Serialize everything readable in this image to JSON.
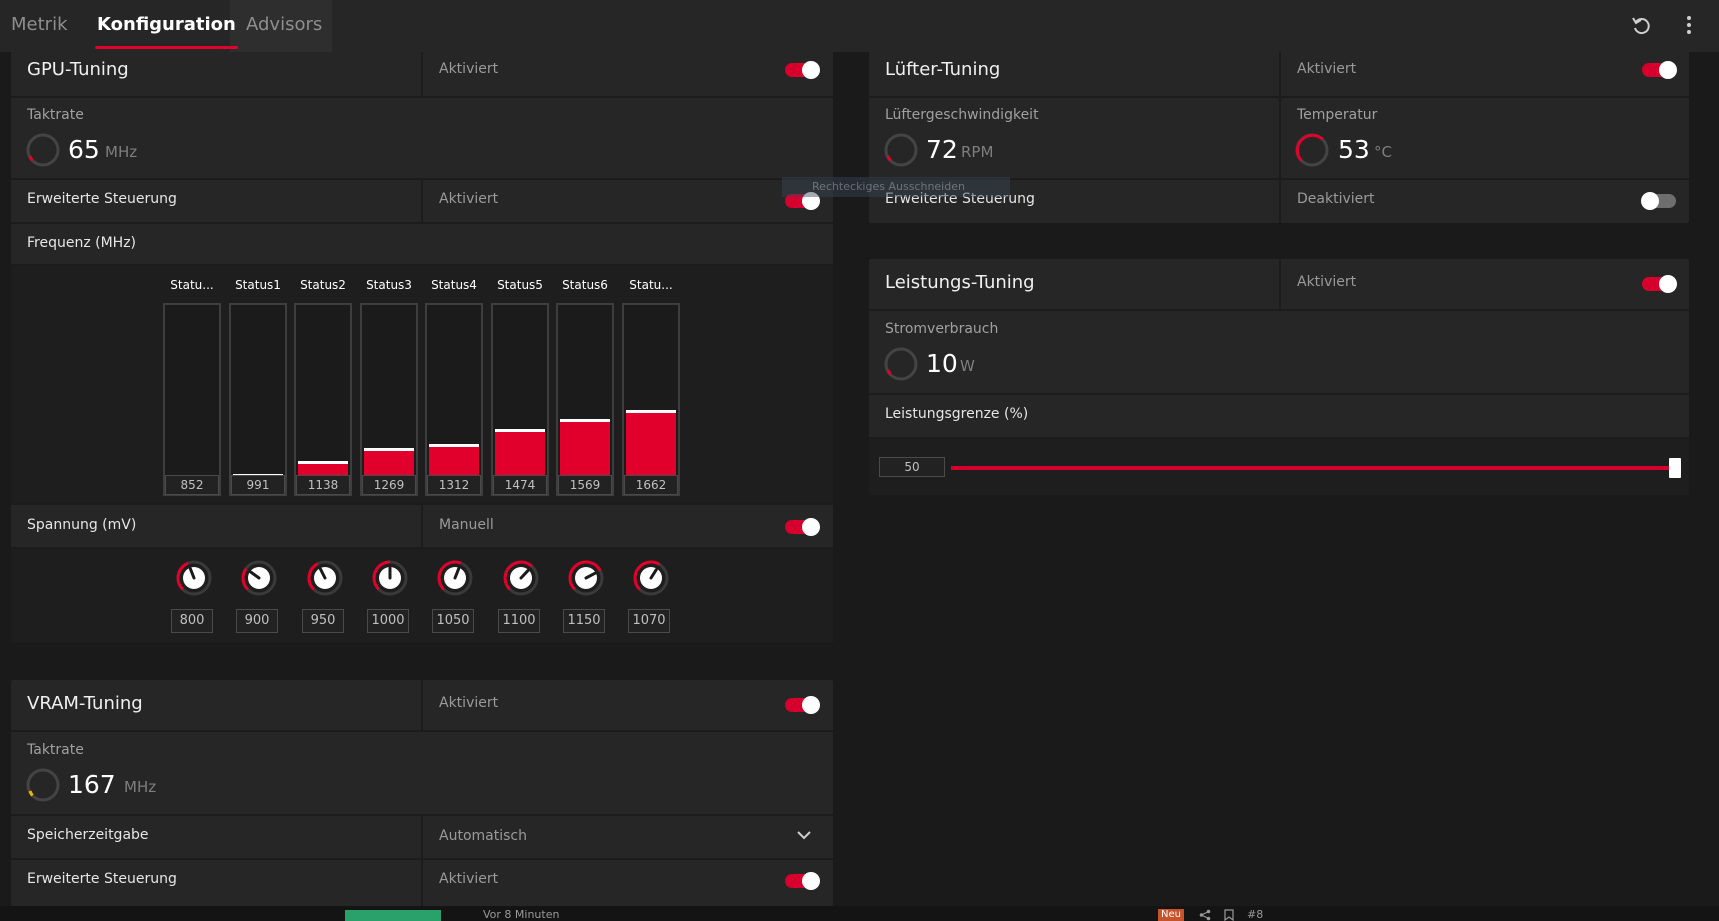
{
  "tabs": [
    {
      "label": "Metrik"
    },
    {
      "label": "Konfiguration"
    },
    {
      "label": "Advisors"
    }
  ],
  "colors": {
    "accent": "#e0002b",
    "panel": "#262626",
    "background": "#1a1a1a"
  },
  "gpu_tuning": {
    "title": "GPU-Tuning",
    "status": "Aktiviert",
    "clock_label": "Taktrate",
    "clock_value": "65",
    "clock_unit": "MHz",
    "advanced_label": "Erweiterte Steuerung",
    "advanced_status": "Aktiviert",
    "freq_label": "Frequenz (MHz)",
    "states": [
      {
        "name": "Statu...",
        "value": "852",
        "level": 0.02
      },
      {
        "name": "Status1",
        "value": "991",
        "level": 0.09
      },
      {
        "name": "Status2",
        "value": "1138",
        "level": 0.16
      },
      {
        "name": "Status3",
        "value": "1269",
        "level": 0.23
      },
      {
        "name": "Status4",
        "value": "1312",
        "level": 0.25
      },
      {
        "name": "Status5",
        "value": "1474",
        "level": 0.33
      },
      {
        "name": "Status6",
        "value": "1569",
        "level": 0.38
      },
      {
        "name": "Statu...",
        "value": "1662",
        "level": 0.43
      }
    ],
    "voltage_label": "Spannung (mV)",
    "voltage_mode": "Manuell",
    "voltages": [
      {
        "value": "800",
        "level": 0.42
      },
      {
        "value": "900",
        "level": 0.3
      },
      {
        "value": "950",
        "level": 0.4
      },
      {
        "value": "1000",
        "level": 0.5
      },
      {
        "value": "1050",
        "level": 0.58
      },
      {
        "value": "1100",
        "level": 0.66
      },
      {
        "value": "1150",
        "level": 0.73
      },
      {
        "value": "1070",
        "level": 0.62
      }
    ]
  },
  "vram_tuning": {
    "title": "VRAM-Tuning",
    "status": "Aktiviert",
    "clock_label": "Taktrate",
    "clock_value": "167",
    "clock_unit": "MHz",
    "timing_label": "Speicherzeitgabe",
    "timing_value": "Automatisch",
    "advanced_label": "Erweiterte Steuerung",
    "advanced_status": "Aktiviert"
  },
  "fan_tuning": {
    "title": "Lüfter-Tuning",
    "status": "Aktiviert",
    "speed_label": "Lüftergeschwindigkeit",
    "speed_value": "72",
    "speed_unit": "RPM",
    "temp_label": "Temperatur",
    "temp_value": "53",
    "temp_unit": "°C",
    "advanced_label": "Erweiterte Steuerung",
    "advanced_status": "Deaktiviert"
  },
  "power_tuning": {
    "title": "Leistungs-Tuning",
    "status": "Aktiviert",
    "power_label": "Stromverbrauch",
    "power_value": "10",
    "power_unit": "W",
    "limit_label": "Leistungsgrenze (%)",
    "limit_value": "50",
    "limit_level": 1.0
  },
  "overlay": {
    "tooltip": "Rechteckiges Ausschneiden",
    "bottom_time": "Vor 8 Minuten",
    "badge": "Neu",
    "hash": "#8"
  }
}
